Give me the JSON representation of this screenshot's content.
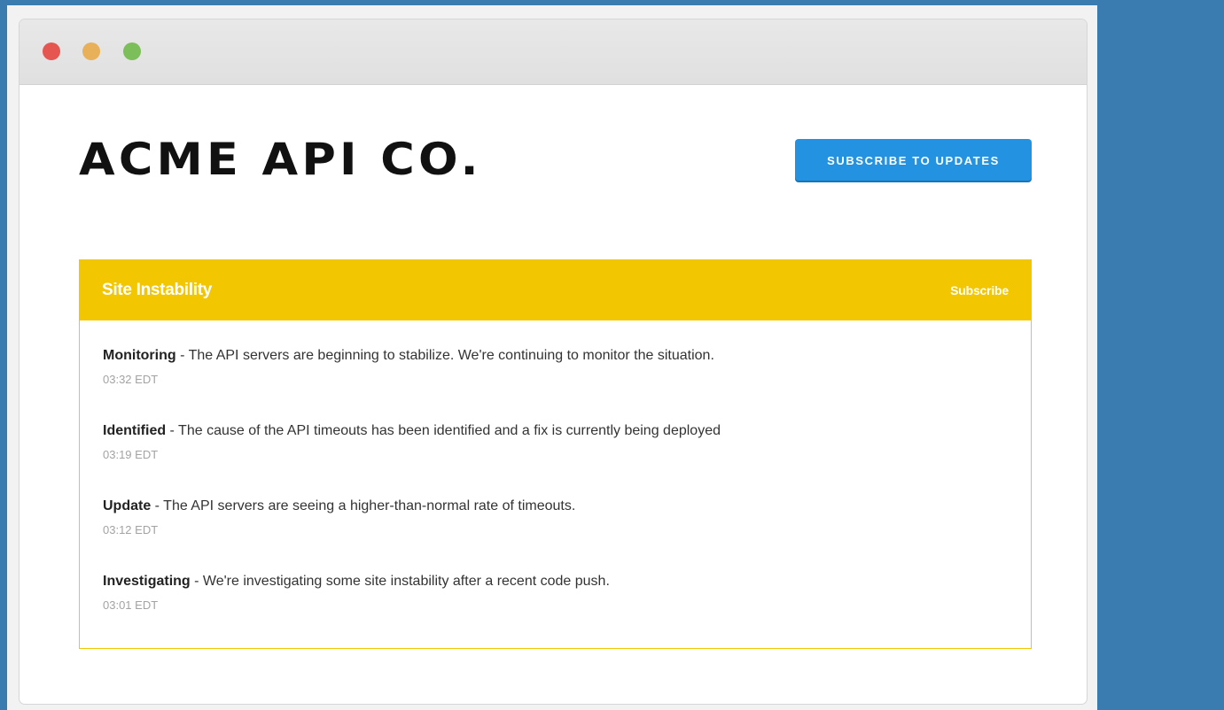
{
  "window": {
    "controls": [
      "close-button",
      "minimize-button",
      "zoom-button"
    ]
  },
  "header": {
    "brand": "ACME API CO.",
    "subscribe_button": "SUBSCRIBE TO UPDATES"
  },
  "incident": {
    "title": "Site Instability",
    "subscribe_link": "Subscribe",
    "updates": [
      {
        "status": "Monitoring",
        "separator": " - ",
        "message": "The API servers are beginning to stabilize. We're continuing to monitor the situation.",
        "time": "03:32 EDT"
      },
      {
        "status": "Identified",
        "separator": " - ",
        "message": "The cause of the API timeouts has been identified and a fix is currently being deployed",
        "time": "03:19 EDT"
      },
      {
        "status": "Update",
        "separator": " - ",
        "message": "The API servers are seeing a higher-than-normal rate of timeouts.",
        "time": "03:12 EDT"
      },
      {
        "status": "Investigating",
        "separator": " - ",
        "message": "We're investigating some site instability after a recent code push.",
        "time": "03:01 EDT"
      }
    ]
  },
  "colors": {
    "background": "#3a7cb0",
    "accent": "#2392e0",
    "incident": "#f2c600",
    "window_close": "#e65650",
    "window_minimize": "#e7b059",
    "window_zoom": "#7cbf5a"
  }
}
